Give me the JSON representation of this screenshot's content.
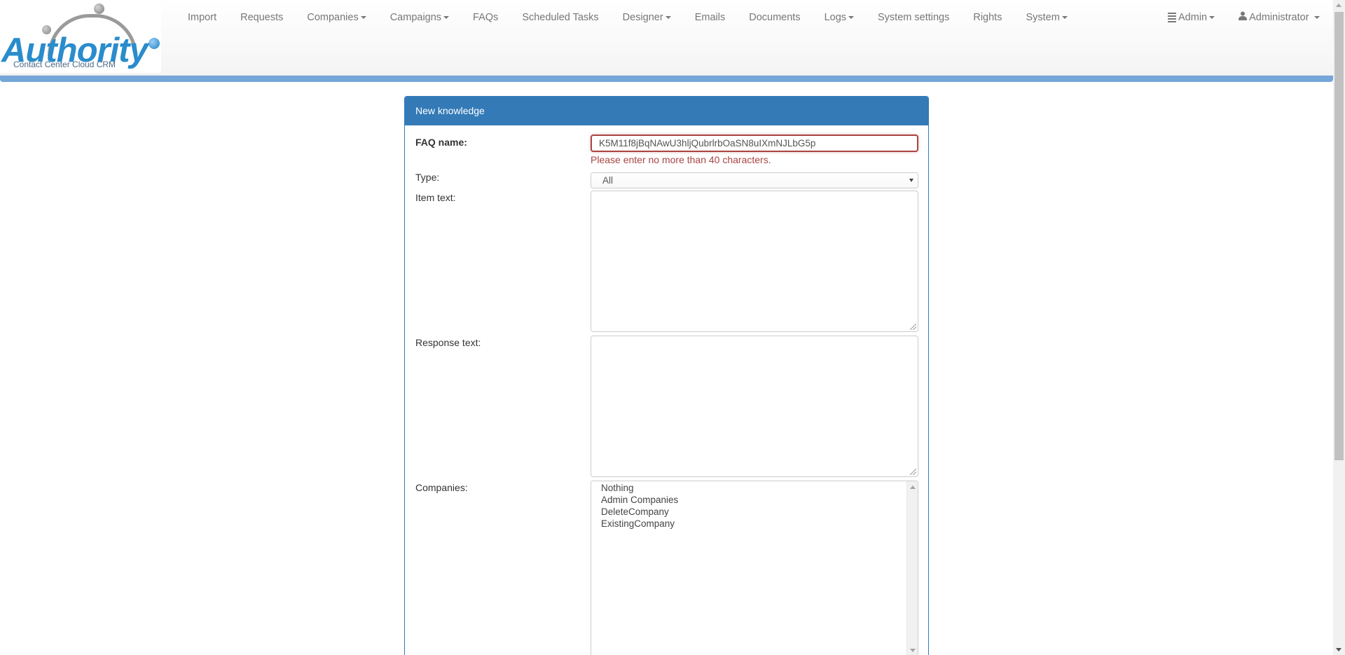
{
  "logo": {
    "word": "Authority",
    "tagline": "Contact Center Cloud CRM"
  },
  "nav": {
    "items": [
      {
        "label": "Import",
        "dropdown": false
      },
      {
        "label": "Requests",
        "dropdown": false
      },
      {
        "label": "Companies",
        "dropdown": true
      },
      {
        "label": "Campaigns",
        "dropdown": true
      },
      {
        "label": "FAQs",
        "dropdown": false
      },
      {
        "label": "Scheduled Tasks",
        "dropdown": false
      },
      {
        "label": "Designer",
        "dropdown": true
      },
      {
        "label": "Emails",
        "dropdown": false
      },
      {
        "label": "Documents",
        "dropdown": false
      },
      {
        "label": "Logs",
        "dropdown": true
      },
      {
        "label": "System settings",
        "dropdown": false
      },
      {
        "label": "Rights",
        "dropdown": false
      },
      {
        "label": "System",
        "dropdown": true
      }
    ],
    "admin_menu": "Admin",
    "user_menu": "Administrator"
  },
  "form": {
    "title": "New knowledge",
    "faq_name_label": "FAQ name:",
    "faq_name_value": "K5M11f8jBqNAwU3hljQubrlrbOaSN8uIXmNJLbG5p",
    "faq_name_error": "Please enter no more than 40 characters.",
    "type_label": "Type:",
    "type_value": "All",
    "item_text_label": "Item text:",
    "item_text_value": "",
    "response_text_label": "Response text:",
    "response_text_value": "",
    "companies_label": "Companies:",
    "companies_options": [
      "Nothing",
      "Admin Companies",
      "DeleteCompany",
      "ExistingCompany"
    ]
  },
  "colors": {
    "primary": "#337ab7",
    "header_strip": "#74a6d8",
    "error": "#a94442",
    "logo_blue": "#2a8ccc"
  }
}
